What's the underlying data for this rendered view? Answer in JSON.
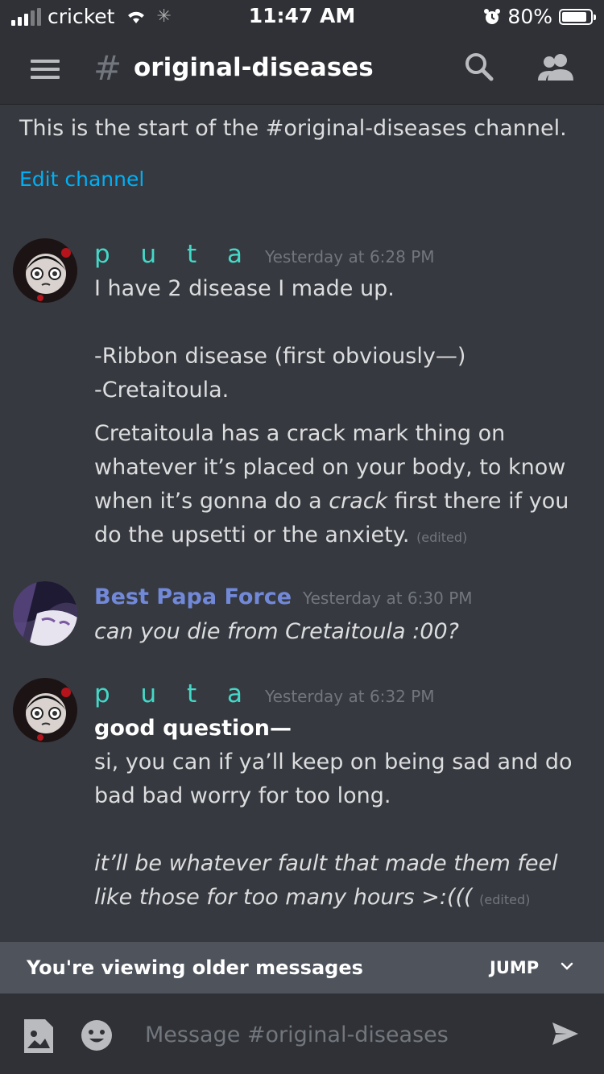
{
  "status": {
    "carrier": "cricket",
    "time": "11:47 AM",
    "battery": "80%"
  },
  "header": {
    "hash": "#",
    "channel": "original-diseases"
  },
  "intro": {
    "text": "This is the start of the #original-diseases channel.",
    "edit_link": "Edit channel"
  },
  "messages": [
    {
      "author": "p u t a",
      "timestamp": "Yesterday at 6:28 PM",
      "lines": [
        "I have 2 disease I made up.",
        "",
        "-Ribbon disease (first obviously—)",
        "-Cretaitoula."
      ],
      "second_part_1": "Cretaitoula has a crack mark thing on whatever it’s placed on your body, to know when it’s gonna do a ",
      "second_italic": "crack",
      "second_part_2": " first there if you do the upsetti or the anxiety.",
      "edited": "(edited)"
    },
    {
      "author": "Best Papa Force",
      "timestamp": "Yesterday at 6:30 PM",
      "text": "can you die from Cretaitoula :00?"
    },
    {
      "author": "p u t a",
      "timestamp": "Yesterday at 6:32 PM",
      "bold_line": "good question—",
      "text": "si, you can if ya’ll keep on being sad and do bad bad worry for too long.",
      "italic_text": "it’ll be whatever fault that made them feel like those for too many hours >:(((",
      "edited": "(edited)"
    }
  ],
  "older_bar": {
    "text": "You're viewing older messages",
    "jump": "JUMP"
  },
  "composer": {
    "placeholder": "Message #original-diseases"
  },
  "icons": [
    "signal-icon",
    "wifi-icon",
    "alarm-icon",
    "battery-icon",
    "menu-icon",
    "search-icon",
    "members-icon",
    "chevron-down-icon",
    "image-icon",
    "emoji-icon",
    "send-icon"
  ],
  "colors": {
    "background": "#36393f",
    "header": "#2f3136",
    "link": "#00b0f4",
    "name_puta": "#43d9c8",
    "name_best": "#7289da",
    "older_bar": "#4f545c"
  }
}
